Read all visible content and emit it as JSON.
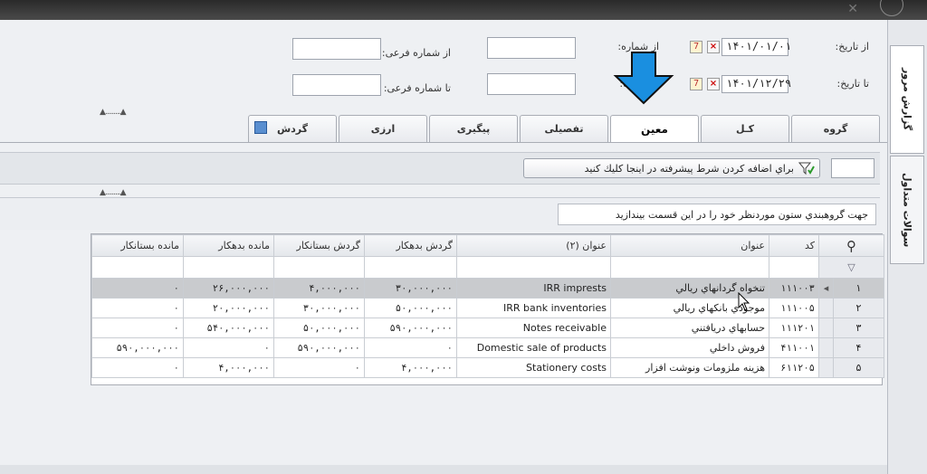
{
  "header": {
    "from_date_label": "از تاریخ:",
    "to_date_label": "تا تاریخ:",
    "from_date_value": "۱۴۰۱/۰۱/۰۱",
    "to_date_value": "۱۴۰۱/۱۲/۲۹",
    "from_number_label": "از شماره:",
    "to_number_label": "تا شماره:",
    "from_sub_number_label": "از شماره فرعی:",
    "to_sub_number_label": "تا شماره فرعی:"
  },
  "side_tabs": [
    "گزارش مرور",
    "سوالات متداول"
  ],
  "tabs": [
    "گروه",
    "کـل",
    "معین",
    "تفصیلی",
    "پیگیری",
    "ارزی",
    "گردش"
  ],
  "active_tab": "معین",
  "filter_button_label": "براي اضافه كردن شرط پيشرفته در اينجا كليك كنيد",
  "group_hint": "جهت گروهبندي ستون موردنظر خود را در اين قسمت بيندازيد",
  "table": {
    "columns": [
      "کد",
      "عنوان",
      "عنوان (۲)",
      "گردش بدهکار",
      "گردش بستانکار",
      "مانده بدهکار",
      "مانده بستانکار"
    ],
    "rows": [
      {
        "n": "۱",
        "code": "۱۱۱۰۰۳",
        "title": "تنخواه گردانهاي ريالي",
        "title2": "IRR imprests",
        "debit_turnover": "۳۰,۰۰۰,۰۰۰",
        "credit_turnover": "۴,۰۰۰,۰۰۰",
        "debit_balance": "۲۶,۰۰۰,۰۰۰",
        "credit_balance": "۰"
      },
      {
        "n": "۲",
        "code": "۱۱۱۰۰۵",
        "title": "موجودي بانكهاي ريالي",
        "title2": "IRR bank inventories",
        "debit_turnover": "۵۰,۰۰۰,۰۰۰",
        "credit_turnover": "۳۰,۰۰۰,۰۰۰",
        "debit_balance": "۲۰,۰۰۰,۰۰۰",
        "credit_balance": "۰"
      },
      {
        "n": "۳",
        "code": "۱۱۱۲۰۱",
        "title": "حسابهاي دريافتني",
        "title2": "Notes receivable",
        "debit_turnover": "۵۹۰,۰۰۰,۰۰۰",
        "credit_turnover": "۵۰,۰۰۰,۰۰۰",
        "debit_balance": "۵۴۰,۰۰۰,۰۰۰",
        "credit_balance": "۰"
      },
      {
        "n": "۴",
        "code": "۴۱۱۰۰۱",
        "title": "فروش داخلي",
        "title2": "Domestic sale of products",
        "debit_turnover": "۰",
        "credit_turnover": "۵۹۰,۰۰۰,۰۰۰",
        "debit_balance": "۰",
        "credit_balance": "۵۹۰,۰۰۰,۰۰۰"
      },
      {
        "n": "۵",
        "code": "۶۱۱۲۰۵",
        "title": "هزينه ملزومات ونوشت افزار",
        "title2": "Stationery costs",
        "debit_turnover": "۴,۰۰۰,۰۰۰",
        "credit_turnover": "۰",
        "debit_balance": "۴,۰۰۰,۰۰۰",
        "credit_balance": "۰"
      }
    ]
  },
  "colors": {
    "accent_arrow": "#1a8fe0",
    "selected_row": "#c9cbce"
  }
}
